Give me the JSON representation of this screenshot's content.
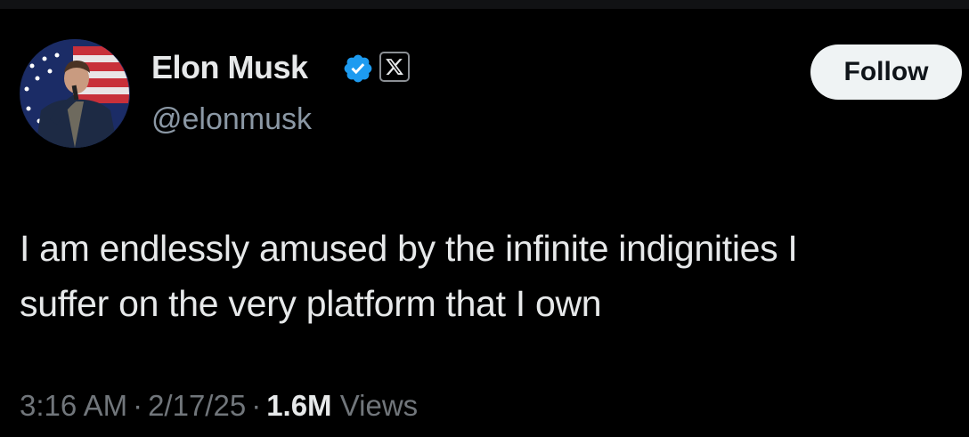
{
  "tweet": {
    "author": {
      "display_name": "Elon Musk",
      "handle": "@elonmusk",
      "verified_icon": "verified-badge-icon",
      "affiliation_icon": "x-logo-icon",
      "avatar_icon": "profile-photo"
    },
    "follow_label": "Follow",
    "text_lines": [
      "I am endlessly amused by the infinite indignities I",
      "suffer on the very platform that I own"
    ],
    "meta": {
      "time": "3:16 AM",
      "separator": "·",
      "date": "2/17/25",
      "views_count": "1.6M",
      "views_label": "Views"
    }
  },
  "colors": {
    "background": "#000000",
    "text_primary": "#e7e9ea",
    "text_secondary": "#71767b",
    "verified_blue": "#1d9bf0",
    "follow_button_bg": "#eff3f4"
  }
}
